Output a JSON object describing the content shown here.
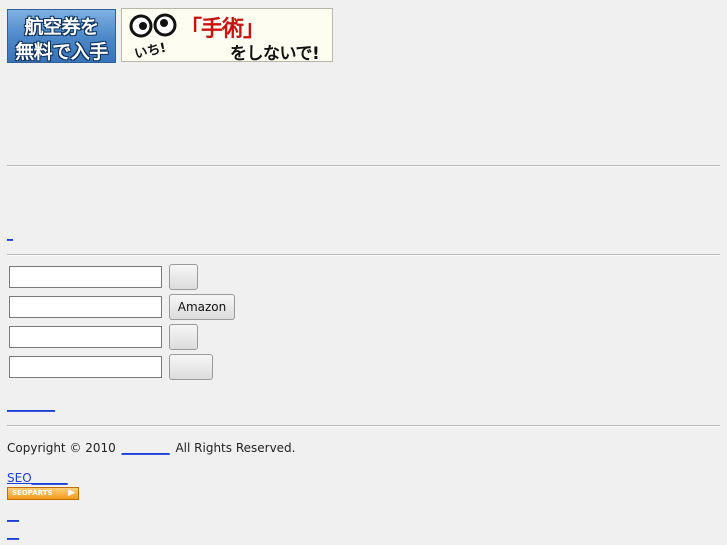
{
  "banners": {
    "flight": {
      "line1": "航空券を",
      "line2": "無料で入手"
    },
    "surgery": {
      "main": "「手術」",
      "small": "いち!",
      "sub": "をしないで!"
    }
  },
  "links": {
    "top_mini": "_",
    "after_form": "________",
    "copyright_link": "________",
    "seo": "SEO______",
    "bottom1": "__",
    "bottom2": "__"
  },
  "form": {
    "rows": [
      {
        "value": "",
        "button": ""
      },
      {
        "value": "",
        "button": "Amazon"
      },
      {
        "value": "",
        "button": ""
      },
      {
        "value": "",
        "button": ""
      }
    ]
  },
  "footer": {
    "copyright_prefix": "Copyright © 2010",
    "copyright_suffix": "All Rights Reserved.",
    "seo_badge": "SEOPARTS"
  }
}
